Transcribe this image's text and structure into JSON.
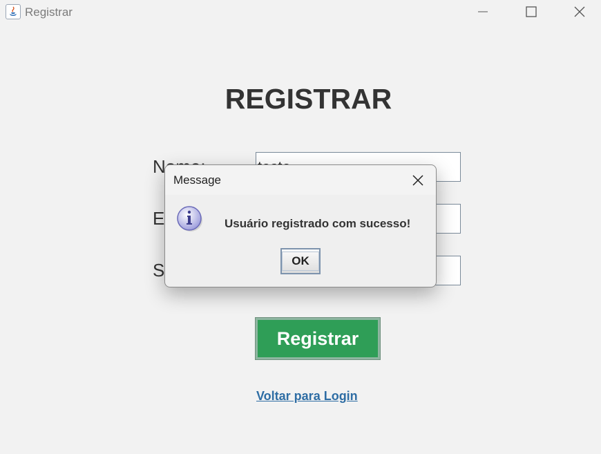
{
  "window": {
    "title": "Registrar"
  },
  "form": {
    "heading": "REGISTRAR",
    "fields": [
      {
        "label": "Nome:",
        "value": "teste"
      },
      {
        "label": "Email:",
        "value": ""
      },
      {
        "label": "Senha:",
        "value": ""
      }
    ],
    "register_label": "Registrar",
    "back_link": "Voltar para Login"
  },
  "dialog": {
    "title": "Message",
    "message": "Usuário registrado com sucesso!",
    "ok_label": "OK",
    "icon": "info-icon"
  },
  "colors": {
    "accent_green": "#2f9e57",
    "link_blue": "#2e6da4",
    "background": "#f2f2f2"
  }
}
